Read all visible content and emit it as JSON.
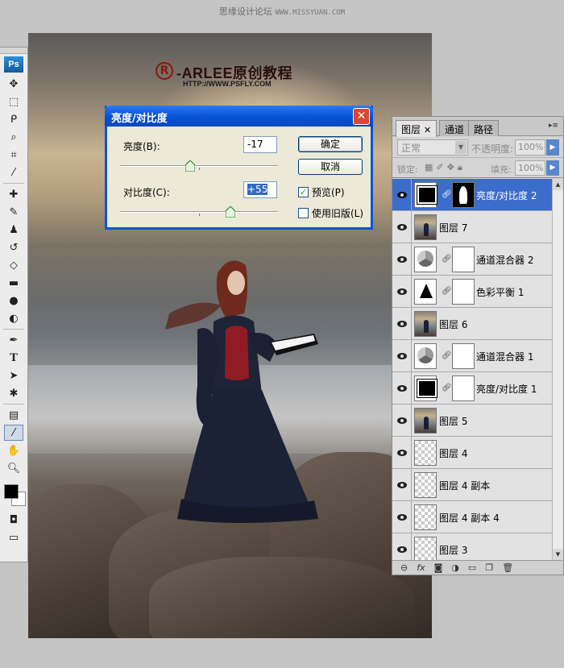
{
  "watermark": {
    "text": "思缘设计论坛",
    "site": "WWW.MISSYUAN.COM"
  },
  "canvas_logo": {
    "mark": "R",
    "name": "-ARLEE原创教程",
    "url": "HTTP://WWW.PSFLY.COM"
  },
  "toolbox": {
    "app_badge": "Ps",
    "tools": [
      "move-icon",
      "marquee-icon",
      "lasso-icon",
      "quick-select-icon",
      "crop-icon",
      "eyedropper-icon",
      "healing-icon",
      "brush-icon",
      "stamp-icon",
      "history-brush-icon",
      "eraser-icon",
      "gradient-icon",
      "blur-icon",
      "dodge-icon",
      "pen-icon",
      "type-icon",
      "path-select-icon",
      "shape-icon",
      "notes-icon",
      "eyedropper-active-icon",
      "hand-icon",
      "zoom-icon"
    ],
    "type_glyph": "T"
  },
  "dialog": {
    "title": "亮度/对比度",
    "close": "✕",
    "brightness_label": "亮度(B):",
    "brightness_value": "-17",
    "brightness_level": -17,
    "contrast_label": "对比度(C):",
    "contrast_value": "+55",
    "contrast_level": 55,
    "ok_label": "确定",
    "cancel_label": "取消",
    "preview_label": "预览(P)",
    "preview_checked": true,
    "legacy_label": "使用旧版(L)",
    "legacy_checked": false
  },
  "layers_panel": {
    "tabs": [
      {
        "label": "图层",
        "active": true
      },
      {
        "label": "通道",
        "active": false
      },
      {
        "label": "路径",
        "active": false
      }
    ],
    "tab_close": "✕",
    "blend_mode": "正常",
    "opacity_label": "不透明度:",
    "opacity_value": "100%",
    "lock_label": "锁定:",
    "fill_label": "填充:",
    "fill_value": "100%",
    "layers": [
      {
        "name": "亮度/对比度 2",
        "thumb": "adj-bc",
        "mask": "mask-black",
        "selected": true
      },
      {
        "name": "图层 7",
        "thumb": "photo",
        "mask": null,
        "selected": false
      },
      {
        "name": "通道混合器 2",
        "thumb": "adj-mix",
        "mask": "white",
        "selected": false
      },
      {
        "name": "色彩平衡 1",
        "thumb": "adj-cb",
        "mask": "white",
        "selected": false
      },
      {
        "name": "图层 6",
        "thumb": "photo",
        "mask": null,
        "selected": false
      },
      {
        "name": "通道混合器 1",
        "thumb": "adj-mix",
        "mask": "white",
        "selected": false
      },
      {
        "name": "亮度/对比度 1",
        "thumb": "adj-bc",
        "mask": "white",
        "selected": false
      },
      {
        "name": "图层 5",
        "thumb": "photo",
        "mask": null,
        "selected": false
      },
      {
        "name": "图层 4",
        "thumb": "checker",
        "mask": null,
        "selected": false
      },
      {
        "name": "图层 4 副本",
        "thumb": "checker",
        "mask": null,
        "selected": false
      },
      {
        "name": "图层 4 副本 4",
        "thumb": "checker",
        "mask": null,
        "selected": false
      },
      {
        "name": "图层 3",
        "thumb": "checker",
        "mask": null,
        "selected": false
      }
    ],
    "footer_icons": [
      "link-layers-icon",
      "fx-icon",
      "add-mask-icon",
      "adjustment-layer-icon",
      "new-group-icon",
      "new-layer-icon",
      "trash-icon"
    ]
  },
  "colors": {
    "dialog_title_bar": "#0853d9",
    "selected_layer": "#3c6ccc",
    "foreground_color": "#000000",
    "background_color": "#ffffff"
  }
}
